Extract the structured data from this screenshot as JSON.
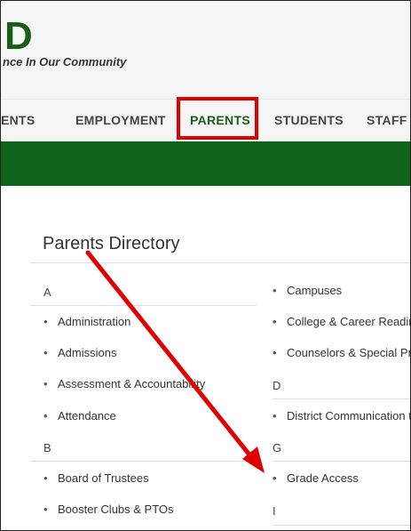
{
  "header": {
    "logo_letter": "D",
    "tagline": "nce In Our Community"
  },
  "nav": {
    "items": [
      {
        "label": "ENTS"
      },
      {
        "label": "EMPLOYMENT"
      },
      {
        "label": "PARENTS",
        "active": true
      },
      {
        "label": "STUDENTS"
      },
      {
        "label": "STAFF"
      }
    ]
  },
  "directory": {
    "title": "Parents Directory",
    "left_column": {
      "section_a": "A",
      "a_items": [
        "Administration",
        "Admissions",
        "Assessment & Accountability",
        "Attendance"
      ],
      "section_b": "B",
      "b_items": [
        "Board of Trustees",
        "Booster Clubs & PTOs"
      ]
    },
    "right_column": {
      "c_items": [
        "Campuses",
        "College & Career Readine",
        "Counselors & Special Pro"
      ],
      "section_d": "D",
      "d_items": [
        "District Communication t"
      ],
      "section_g": "G",
      "g_items": [
        "Grade Access"
      ],
      "section_i": "I"
    }
  },
  "colors": {
    "brand_green": "#10631b",
    "highlight_red": "#e00000"
  }
}
